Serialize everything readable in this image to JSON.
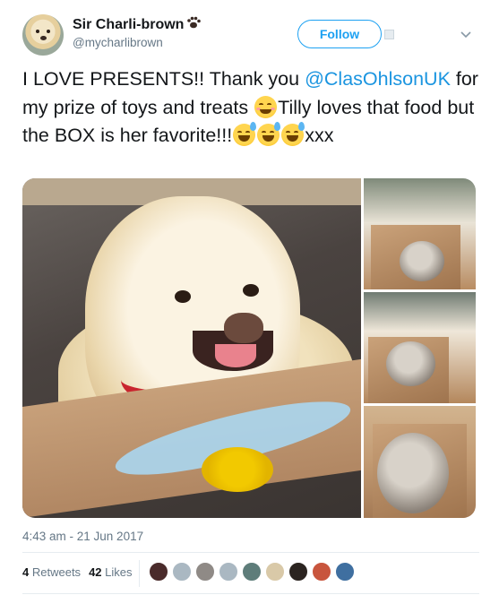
{
  "user": {
    "display_name": "Sir Charli-brown",
    "username": "@mycharlibrown"
  },
  "follow_label": "Follow",
  "tweet": {
    "text_1": "I LOVE PRESENTS!! Thank you ",
    "mention": "@ClasOhlsonUK",
    "text_2": " for my prize of toys and treats ",
    "text_3": "Tilly loves that food but the BOX is her favorite!!!",
    "text_4": "xxx"
  },
  "timestamp": "4:43 am - 21 Jun 2017",
  "stats": {
    "retweets_count": "4",
    "retweets_label": "Retweets",
    "likes_count": "42",
    "likes_label": "Likes"
  },
  "icons": {
    "paw": "paw-prints-icon",
    "chevron": "chevron-down-icon",
    "emoji_blush": "smiling-face-with-smiling-eyes",
    "emoji_sweat": "grinning-face-with-sweat"
  },
  "colors": {
    "accent": "#1da1f2",
    "link": "#1b95e0",
    "secondary_text": "#657786",
    "collar": "#c9252e"
  },
  "likers": [
    {
      "color": "#4a2b2b"
    },
    {
      "color": "#aab8c2"
    },
    {
      "color": "#8f8a86"
    },
    {
      "color": "#aab8c2"
    },
    {
      "color": "#5e7d7a"
    },
    {
      "color": "#d9c9a8"
    },
    {
      "color": "#2b2420"
    },
    {
      "color": "#c8553d"
    },
    {
      "color": "#3f6fa0"
    }
  ]
}
